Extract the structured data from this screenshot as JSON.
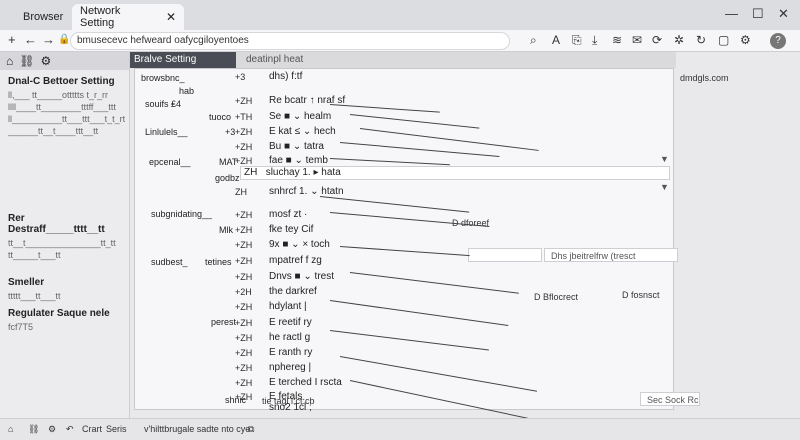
{
  "tabs": [
    {
      "label": "Browser"
    },
    {
      "label": "Network Setting"
    }
  ],
  "window": {
    "minimize": "—",
    "maximize": "☐",
    "close": "✕"
  },
  "address": {
    "url": "bmusecevc hefweard oafycgiloyentoes"
  },
  "sidebar": {
    "title": "Dnal-C Bettoer Setting",
    "lines": [
      "ll,___ tt_____ottttts t_r_rr",
      "llll____tt________tttff___ttt",
      "ll__________tt___ttt___t_t_rt",
      "______tt__t____ttt__tt"
    ],
    "section2_title": "Rer Destraff_____tttt__tt",
    "section2_lines": [
      "tt__t_______________tt_tt",
      "tt_____t___tt"
    ],
    "item_a": "Smeller",
    "item_b": "ttttt___tt___tt",
    "item_c": "Regulater Saque nele",
    "item_d": "fcf7T5"
  },
  "panel": {
    "title": "Bralve Setting",
    "subtitle": "deatinpl heat",
    "right_label": "dmdgls.com"
  },
  "labels": [
    {
      "t": "browsbnc_"
    },
    {
      "t": "hab"
    },
    {
      "t": "souifs ₤4"
    },
    {
      "t": "tuoco"
    },
    {
      "t": "Linlulels__"
    },
    {
      "t": "+3"
    },
    {
      "t": "epcenal__"
    },
    {
      "t": "MAT"
    },
    {
      "t": "godbz"
    },
    {
      "t": "subgnidating__"
    },
    {
      "t": "Mlk"
    },
    {
      "t": "sudbest_"
    },
    {
      "t": "tetines"
    },
    {
      "t": "perest"
    },
    {
      "t": "shnic"
    }
  ],
  "rows": [
    {
      "num": "+3",
      "txt": "dhs) f:tf"
    },
    {
      "num": "+ZH",
      "txt": "Re bcatr  ↑ nraf sf"
    },
    {
      "num": "+TH",
      "txt": "Se ■  ⌄  healm"
    },
    {
      "num": "+ZH",
      "txt": "E  kat ≤  ⌄ hech"
    },
    {
      "num": "+ZH",
      "txt": "Bu  ■  ⌄ tatra"
    },
    {
      "num": "+ZH",
      "txt": "fae ■  ⌄ temb"
    },
    {
      "num": "ZH",
      "txt": "sluchay 1.  ▸ hata"
    },
    {
      "num": "ZH",
      "txt": "snhrcf 1.  ⌄ htatn"
    },
    {
      "num": "+ZH",
      "txt": "mosf zt  ·"
    },
    {
      "num": "+ZH",
      "txt": "fke tey Cif"
    },
    {
      "num": "+ZH",
      "txt": "9x ■  ⌄  ×  toch"
    },
    {
      "num": "+ZH",
      "txt": "mpatref f  zg"
    },
    {
      "num": "+ZH",
      "txt": "Dnvs ■  ⌄ trest"
    },
    {
      "num": "+2H",
      "txt": "the darkref"
    },
    {
      "num": "+ZH",
      "txt": "hdylant  |"
    },
    {
      "num": "+ZH",
      "txt": "E  reetif ry"
    },
    {
      "num": "+ZH",
      "txt": "he ractl g"
    },
    {
      "num": "+ZH",
      "txt": "E  ranth ry"
    },
    {
      "num": "+ZH",
      "txt": "nphereg  |"
    },
    {
      "num": "+ZH",
      "txt": "E  terched  I  rscta"
    },
    {
      "num": "+ZH",
      "txt": "E  fetals"
    },
    {
      "num": "",
      "txt": "sno2 1cl  ;"
    }
  ],
  "floaters": {
    "a": "D dforeef",
    "b": "Dhs jbeitrelfrw (tresct",
    "c": "D Bflocrect",
    "d": "D fosnsct",
    "e": "tie  tagl  l:ct:cb",
    "f": "Sec  Sock  Rc"
  },
  "status": {
    "left1": "Crart",
    "left2": "Seris",
    "center": "v'hilttbrugale sadte nto cye"
  },
  "colors": {
    "panel_header": "#4a4d55",
    "check_green": "#4d9a3a"
  }
}
